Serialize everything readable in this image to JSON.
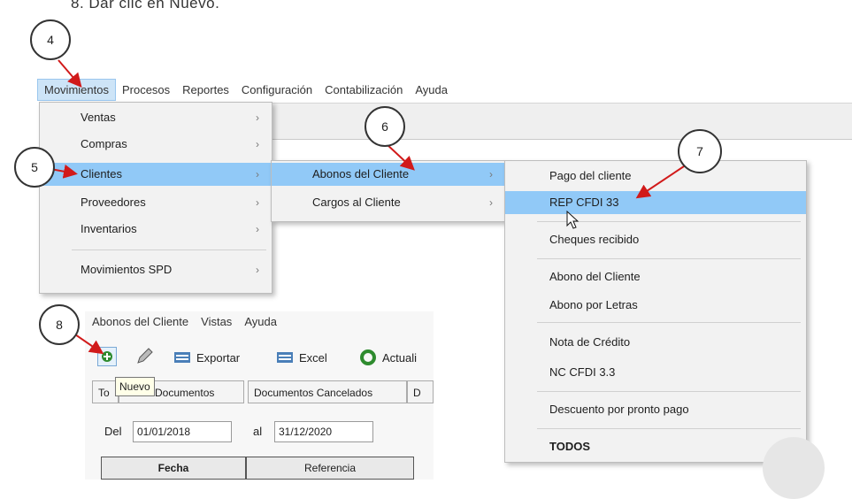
{
  "instruction": "8. Dar clic en Nuevo.",
  "menubar": {
    "items": [
      "Movimientos",
      "Procesos",
      "Reportes",
      "Configuración",
      "Contabilización",
      "Ayuda"
    ]
  },
  "menu1": {
    "items": [
      "Ventas",
      "Compras",
      "Clientes",
      "Proveedores",
      "Inventarios",
      "Movimientos SPD"
    ]
  },
  "menu2": {
    "items": [
      "Abonos del Cliente",
      "Cargos al Cliente"
    ]
  },
  "menu3": {
    "items": [
      "Pago del cliente",
      "REP CFDI 33",
      "Cheques recibido",
      "Abono del Cliente",
      "Abono por Letras",
      "Nota de Crédito",
      "NC CFDI 3.3",
      "Descuento por pronto pago",
      "TODOS"
    ]
  },
  "arrow_glyph": "›",
  "steps": [
    "4",
    "5",
    "6",
    "7",
    "8"
  ],
  "second_window": {
    "menu": [
      "Abonos del Cliente",
      "Vistas",
      "Ayuda"
    ],
    "toolbar": {
      "export": "Exportar",
      "excel": "Excel",
      "refresh": "Actuali"
    },
    "tooltip": "Nuevo",
    "tabs": [
      "To",
      "Documentos",
      "Documentos Cancelados",
      "D"
    ],
    "date_from_label": "Del",
    "date_from": "01/01/2018",
    "date_to_label": "al",
    "date_to": "31/12/2020",
    "columns": [
      "Fecha",
      "Referencia"
    ]
  },
  "colors": {
    "highlight": "#91c9f7",
    "menu_bg": "#f2f2f2",
    "annotation": "#d11a1a"
  }
}
